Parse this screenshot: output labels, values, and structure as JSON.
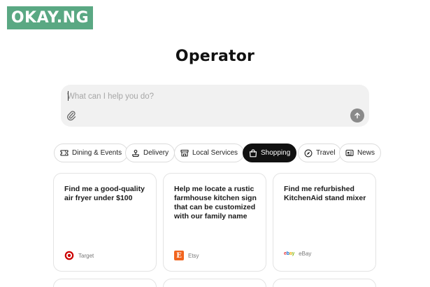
{
  "watermark": {
    "text": "OKAY.NG"
  },
  "header": {
    "title": "Operator"
  },
  "prompt": {
    "placeholder": "What can I help you do?",
    "attach_icon": "paperclip-icon",
    "send_icon": "arrow-up-icon"
  },
  "categories": [
    {
      "label": "Dining & Events",
      "icon": "ticket-icon",
      "active": false
    },
    {
      "label": "Delivery",
      "icon": "delivery-icon",
      "active": false
    },
    {
      "label": "Local Services",
      "icon": "storefront-icon",
      "active": false
    },
    {
      "label": "Shopping",
      "icon": "shopping-bag-icon",
      "active": true
    },
    {
      "label": "Travel",
      "icon": "compass-icon",
      "active": false
    },
    {
      "label": "News",
      "icon": "newspaper-icon",
      "active": false
    }
  ],
  "cards": [
    {
      "text": "Find me a good-quality air fryer under $100",
      "source": "Target",
      "source_icon": "target-logo-icon"
    },
    {
      "text": "Help me locate a rustic farmhouse kitchen sign that can be customized with our family name",
      "source": "Etsy",
      "source_icon": "etsy-logo-icon",
      "source_logo_letter": "E"
    },
    {
      "text": "Find me refurbished KitchenAid stand mixer",
      "source": "eBay",
      "source_icon": "ebay-logo-icon",
      "source_logo_text": "ebay"
    }
  ],
  "colors": {
    "active_chip": "#111111",
    "prompt_bg": "#f1f1f1",
    "send_button": "#8a8a8a",
    "target_red": "#cc0000",
    "etsy_orange": "#f1641e",
    "watermark_green": "#5aa883"
  }
}
